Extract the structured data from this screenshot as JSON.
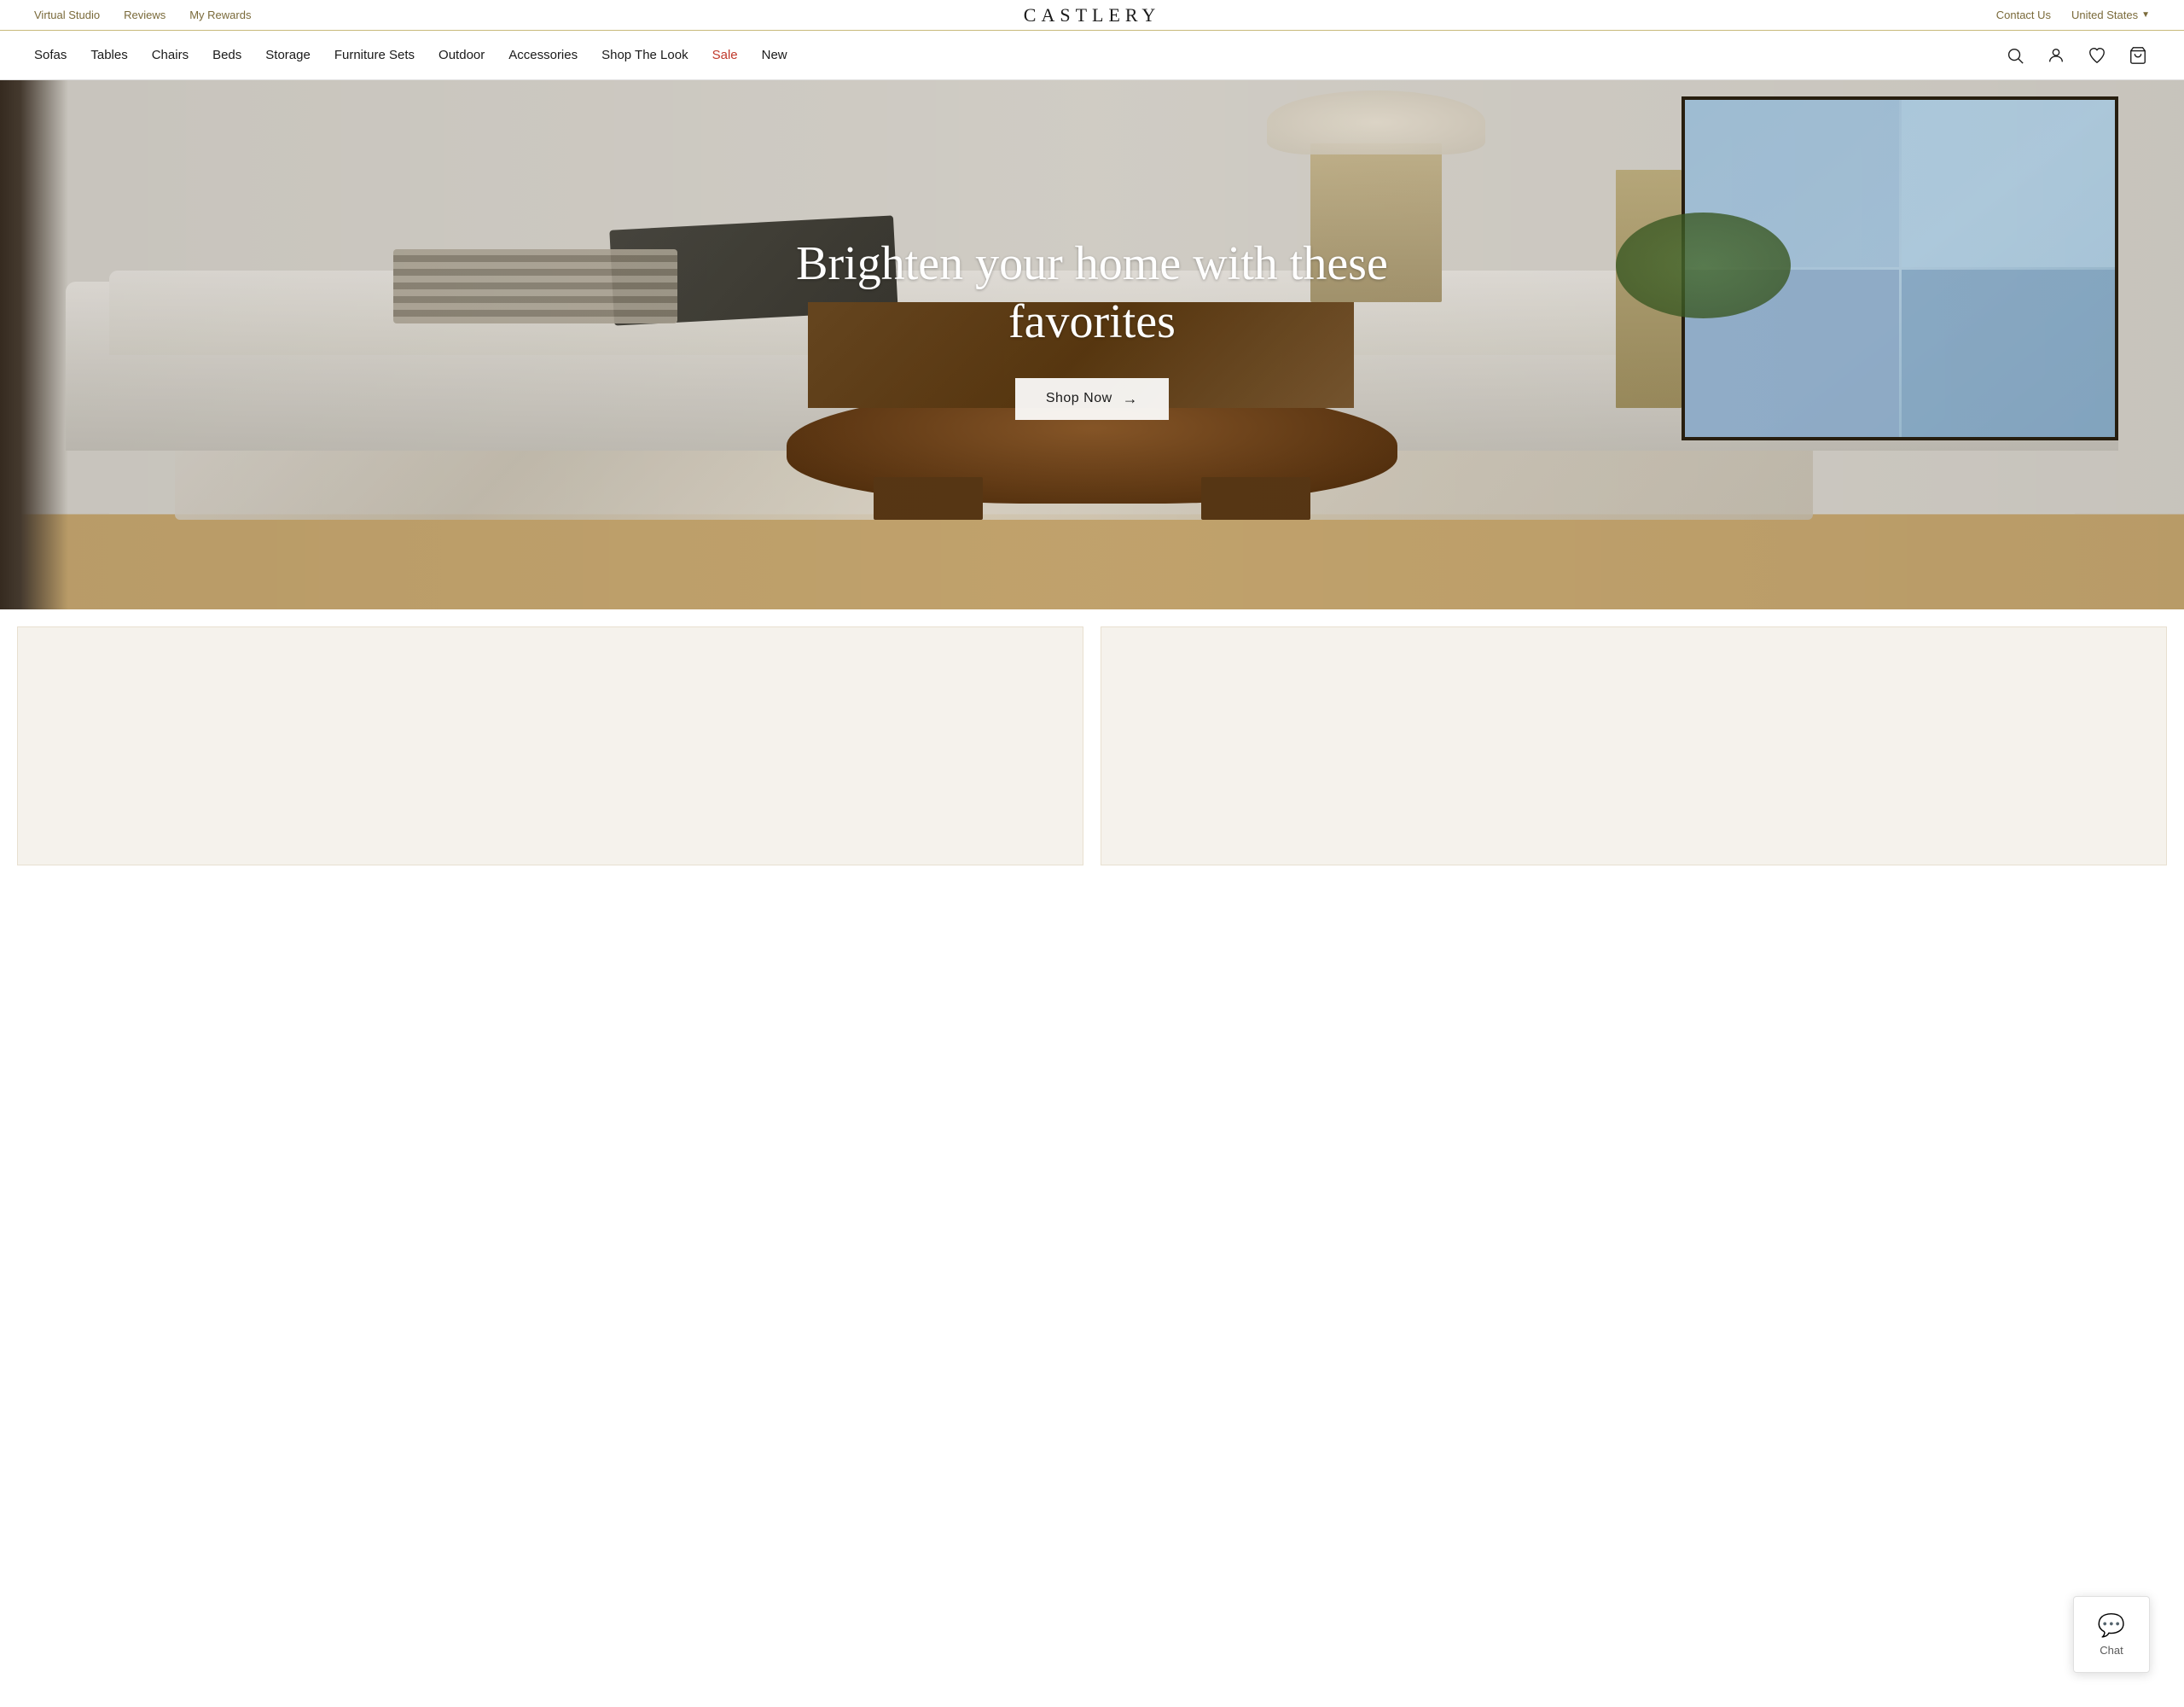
{
  "brand": {
    "name": "CASTLERY"
  },
  "topbar": {
    "left_links": [
      {
        "label": "Virtual Studio",
        "key": "virtual-studio"
      },
      {
        "label": "Reviews",
        "key": "reviews"
      },
      {
        "label": "My Rewards",
        "key": "my-rewards"
      }
    ],
    "right_links": [
      {
        "label": "Contact Us",
        "key": "contact-us"
      }
    ],
    "country": "United States"
  },
  "nav": {
    "links": [
      {
        "label": "Sofas",
        "key": "sofas",
        "sale": false
      },
      {
        "label": "Tables",
        "key": "tables",
        "sale": false
      },
      {
        "label": "Chairs",
        "key": "chairs",
        "sale": false
      },
      {
        "label": "Beds",
        "key": "beds",
        "sale": false
      },
      {
        "label": "Storage",
        "key": "storage",
        "sale": false
      },
      {
        "label": "Furniture Sets",
        "key": "furniture-sets",
        "sale": false
      },
      {
        "label": "Outdoor",
        "key": "outdoor",
        "sale": false
      },
      {
        "label": "Accessories",
        "key": "accessories",
        "sale": false
      },
      {
        "label": "Shop The Look",
        "key": "shop-the-look",
        "sale": false
      },
      {
        "label": "Sale",
        "key": "sale",
        "sale": true
      },
      {
        "label": "New",
        "key": "new",
        "sale": false
      }
    ]
  },
  "hero": {
    "title": "Brighten your home with these favorites",
    "cta_label": "Shop Now"
  },
  "chat": {
    "label": "Chat"
  },
  "cards": [
    {
      "key": "card-1"
    },
    {
      "key": "card-2"
    }
  ]
}
